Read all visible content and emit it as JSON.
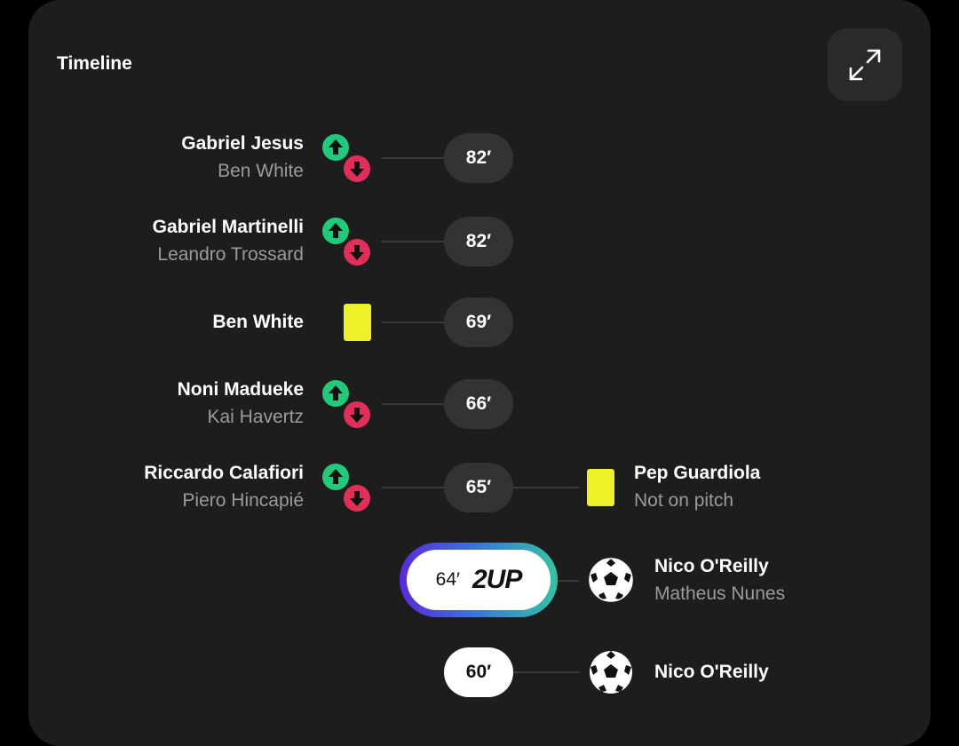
{
  "header": {
    "title": "Timeline",
    "expand_icon": "expand-arrows-icon"
  },
  "events": [
    {
      "minute": "82′",
      "side": "left",
      "type": "substitution",
      "player_in": "Gabriel Jesus",
      "player_out": "Ben White"
    },
    {
      "minute": "82′",
      "side": "left",
      "type": "substitution",
      "player_in": "Gabriel Martinelli",
      "player_out": "Leandro Trossard"
    },
    {
      "minute": "69′",
      "side": "left",
      "type": "yellow-card",
      "player": "Ben White"
    },
    {
      "minute": "66′",
      "side": "left",
      "type": "substitution",
      "player_in": "Noni Madueke",
      "player_out": "Kai Havertz"
    },
    {
      "minute": "65′",
      "side": "both",
      "type": "substitution",
      "player_in": "Riccardo Calafiori",
      "player_out": "Piero Hincapié",
      "right": {
        "type": "yellow-card",
        "player": "Pep Guardiola",
        "note": "Not on pitch"
      }
    },
    {
      "minute": "64′",
      "badge": "2UP",
      "side": "right",
      "type": "goal",
      "scorer": "Nico O'Reilly",
      "assist": "Matheus Nunes"
    },
    {
      "minute": "60′",
      "side": "right",
      "type": "goal",
      "scorer": "Nico O'Reilly"
    }
  ],
  "colors": {
    "card_bg": "#1d1d1d",
    "sub_in": "#22c97a",
    "sub_out": "#e0305a",
    "yellow_card": "#ecf12a",
    "twoup_gradient": [
      "#5a2bd8",
      "#3c6fe0",
      "#35c2a2"
    ]
  }
}
